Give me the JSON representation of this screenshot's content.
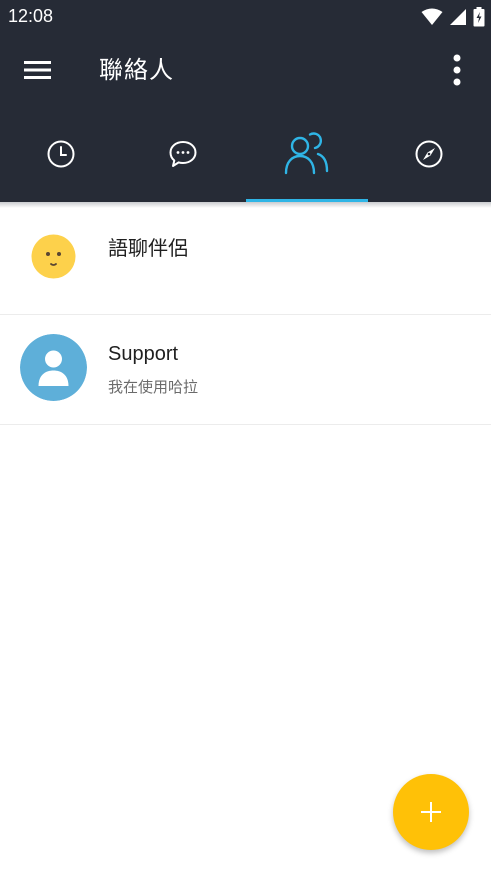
{
  "status_bar": {
    "time": "12:08"
  },
  "app_bar": {
    "title": "聯絡人"
  },
  "tabs": [
    {
      "icon": "clock-icon",
      "selected": false
    },
    {
      "icon": "chat-bubble-icon",
      "selected": false
    },
    {
      "icon": "contacts-people-icon",
      "selected": true
    },
    {
      "icon": "compass-icon",
      "selected": false
    }
  ],
  "contacts": [
    {
      "name": "語聊伴侶",
      "subtitle": ""
    },
    {
      "name": "Support",
      "subtitle": "我在使用哈拉"
    }
  ],
  "colors": {
    "app_bar": "#262b36",
    "accent": "#2fb5e6",
    "fab": "#ffc107",
    "emoji_avatar": "#fdd14b",
    "support_avatar": "#5eafd9"
  }
}
